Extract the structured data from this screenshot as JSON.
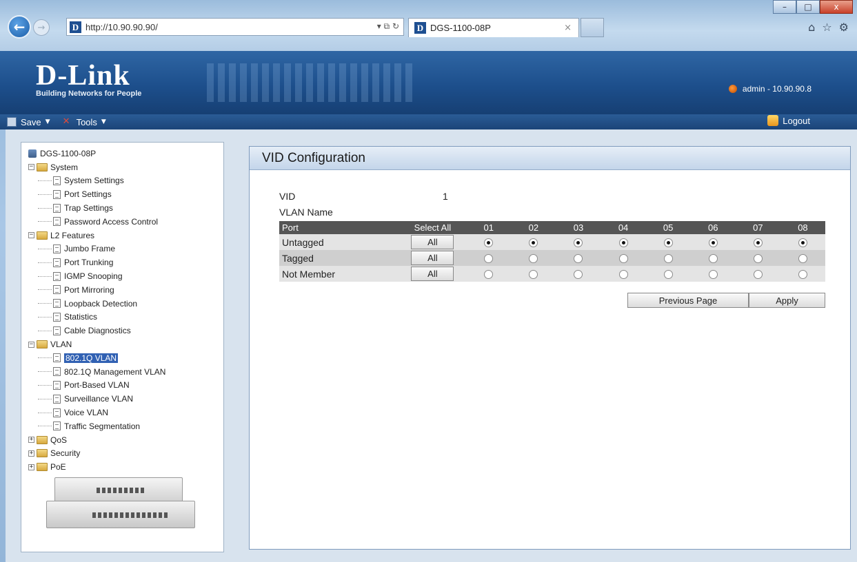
{
  "browser": {
    "url": "http://10.90.90.90/",
    "address_tools": "▾ ⧉ ↻",
    "tab_title": "DGS-1100-08P",
    "tab_close": "×",
    "window_buttons": {
      "minimize": "–",
      "maximize": "□",
      "close": "x"
    },
    "icons": [
      "home-icon",
      "star-icon",
      "gear-icon"
    ]
  },
  "header": {
    "brand": "D-Link",
    "tagline": "Building Networks for People",
    "user_info": "admin - 10.90.90.8"
  },
  "menu": {
    "save": "Save",
    "tools": "Tools",
    "logout": "Logout"
  },
  "tree": {
    "root": "DGS-1100-08P",
    "system": {
      "label": "System",
      "items": [
        "System Settings",
        "Port Settings",
        "Trap Settings",
        "Password Access Control"
      ]
    },
    "l2": {
      "label": "L2 Features",
      "items": [
        "Jumbo Frame",
        "Port Trunking",
        "IGMP Snooping",
        "Port Mirroring",
        "Loopback Detection",
        "Statistics",
        "Cable Diagnostics"
      ]
    },
    "vlan": {
      "label": "VLAN",
      "items": [
        "802.1Q VLAN",
        "802.1Q Management VLAN",
        "Port-Based VLAN",
        "Surveillance VLAN",
        "Voice VLAN",
        "Traffic Segmentation"
      ],
      "selected": "802.1Q VLAN"
    },
    "qos": "QoS",
    "security": "Security",
    "poe": "PoE"
  },
  "panel": {
    "title": "VID Configuration",
    "vid_label": "VID",
    "vid_value": "1",
    "vlan_name_label": "VLAN Name",
    "table": {
      "port_header": "Port",
      "select_all_header": "Select All",
      "ports": [
        "01",
        "02",
        "03",
        "04",
        "05",
        "06",
        "07",
        "08"
      ],
      "rows": [
        {
          "label": "Untagged",
          "button": "All",
          "selected": true
        },
        {
          "label": "Tagged",
          "button": "All",
          "selected": false
        },
        {
          "label": "Not Member",
          "button": "All",
          "selected": false
        }
      ]
    },
    "previous_page": "Previous Page",
    "apply": "Apply"
  }
}
